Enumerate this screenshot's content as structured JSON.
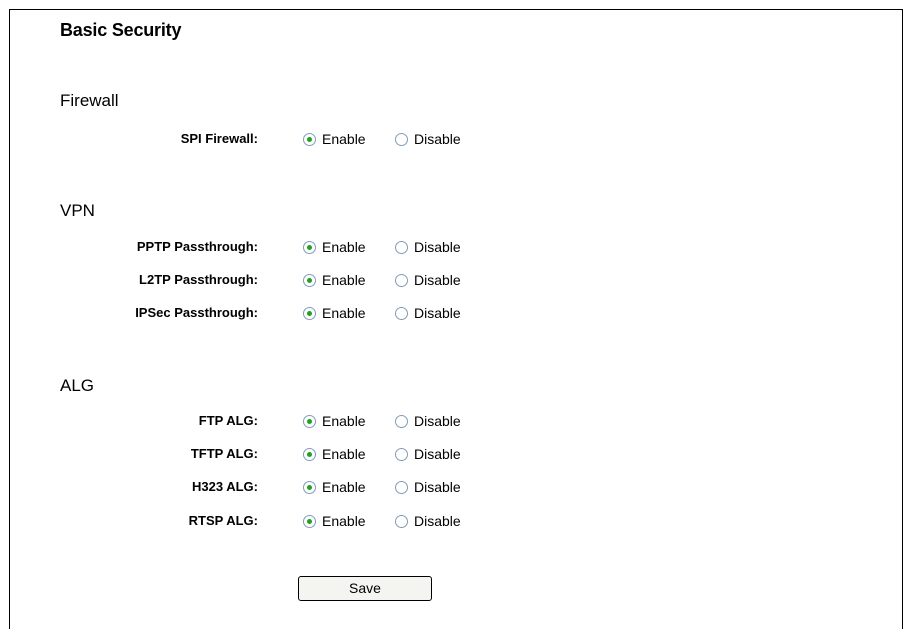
{
  "page": {
    "title": "Basic Security"
  },
  "sections": {
    "firewall": {
      "title": "Firewall"
    },
    "vpn": {
      "title": "VPN"
    },
    "alg": {
      "title": "ALG"
    }
  },
  "options": {
    "enable": "Enable",
    "disable": "Disable"
  },
  "rows": [
    {
      "label": "SPI Firewall:",
      "selected": "Enable"
    },
    {
      "label": "PPTP Passthrough:",
      "selected": "Enable"
    },
    {
      "label": "L2TP Passthrough:",
      "selected": "Enable"
    },
    {
      "label": "IPSec Passthrough:",
      "selected": "Enable"
    },
    {
      "label": "FTP ALG:",
      "selected": "Enable"
    },
    {
      "label": "TFTP ALG:",
      "selected": "Enable"
    },
    {
      "label": "H323 ALG:",
      "selected": "Enable"
    },
    {
      "label": "RTSP ALG:",
      "selected": "Enable"
    }
  ],
  "buttons": {
    "save": "Save"
  }
}
